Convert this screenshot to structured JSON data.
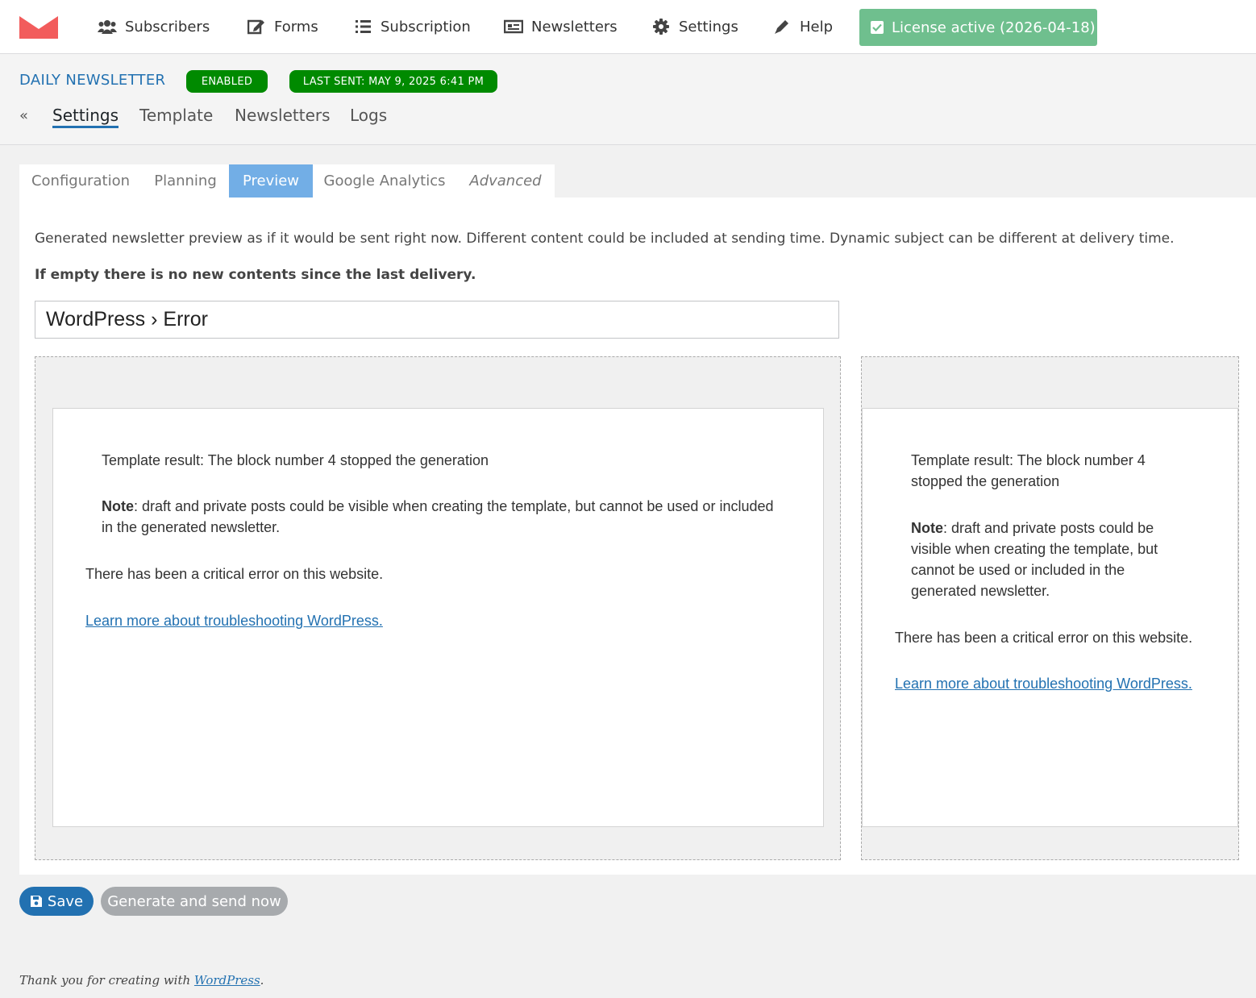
{
  "nav": {
    "items": [
      {
        "label": "Subscribers",
        "icon": "users-icon"
      },
      {
        "label": "Forms",
        "icon": "edit-icon"
      },
      {
        "label": "Subscription",
        "icon": "list-icon"
      },
      {
        "label": "Newsletters",
        "icon": "newspaper-icon"
      },
      {
        "label": "Settings",
        "icon": "gear-icon"
      },
      {
        "label": "Help",
        "icon": "pen-icon"
      }
    ],
    "license": "License active (2026-04-18)"
  },
  "header": {
    "title": "DAILY NEWSLETTER",
    "badge_status": "ENABLED",
    "badge_last_sent": "LAST SENT: MAY 9, 2025 6:41 PM",
    "back": "«",
    "subnav": [
      "Settings",
      "Template",
      "Newsletters",
      "Logs"
    ]
  },
  "tabs": [
    "Configuration",
    "Planning",
    "Preview",
    "Google Analytics",
    "Advanced"
  ],
  "preview": {
    "description": "Generated newsletter preview as if it would be sent right now. Different content could be included at sending time. Dynamic subject can be different at delivery time.",
    "notice": "If empty there is no new contents since the last delivery.",
    "subject": "WordPress › Error",
    "template_result": "Template result: The block number 4 stopped the generation",
    "note_label": "Note",
    "note_text": ": draft and private posts could be visible when creating the template, but cannot be used or included in the generated newsletter.",
    "critical_error": "There has been a critical error on this website.",
    "learn_more": "Learn more about troubleshooting WordPress."
  },
  "actions": {
    "save": "Save",
    "generate": "Generate and send now"
  },
  "footer": {
    "text": "Thank you for creating with ",
    "link": "WordPress",
    "period": "."
  },
  "colors": {
    "accent": "#2271b1",
    "badge_green": "#008a00",
    "license_green": "#6fbf8e",
    "tab_active": "#72aee6",
    "logo_red": "#f25c5c"
  }
}
